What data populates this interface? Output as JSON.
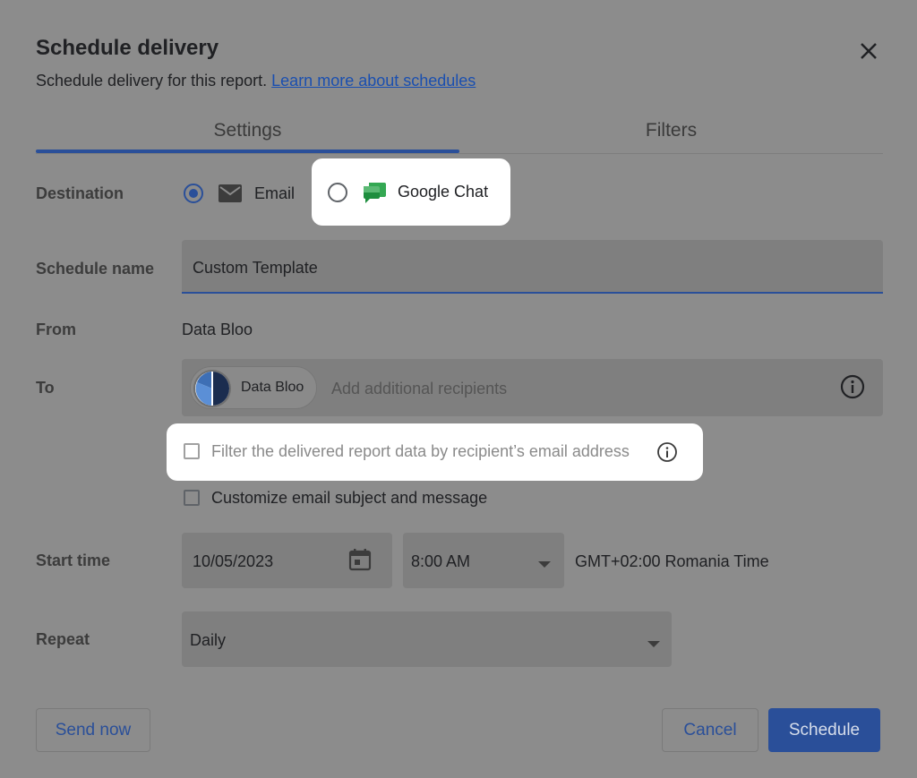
{
  "dialog": {
    "title": "Schedule delivery",
    "subtitle": "Schedule delivery for this report.",
    "learn_more_link": "Learn more about schedules"
  },
  "tabs": [
    {
      "label": "Settings",
      "selected": true
    },
    {
      "label": "Filters",
      "selected": false
    }
  ],
  "destination": {
    "label": "Destination",
    "options": [
      {
        "label": "Email",
        "selected": true,
        "icon": "email-icon"
      },
      {
        "label": "Google Chat",
        "selected": false,
        "icon": "google-chat-icon"
      }
    ]
  },
  "schedule_name": {
    "label": "Schedule name",
    "value": "Custom Template"
  },
  "from": {
    "label": "From",
    "value": "Data Bloo"
  },
  "to": {
    "label": "To",
    "chip_label": "Data Bloo",
    "placeholder": "Add additional recipients"
  },
  "options": {
    "filter_by_email": {
      "label": "Filter the delivered report data by recipient’s email address",
      "checked": false
    },
    "customize_email": {
      "label": "Customize email subject and message",
      "checked": false
    }
  },
  "start_time": {
    "label": "Start time",
    "date": "10/05/2023",
    "time": "8:00 AM",
    "timezone": "GMT+02:00 Romania Time"
  },
  "repeat": {
    "label": "Repeat",
    "value": "Daily"
  },
  "buttons": {
    "send_now": "Send now",
    "cancel": "Cancel",
    "schedule": "Schedule"
  },
  "colors": {
    "accent": "#2a4f99",
    "overlay_background": "#8c8c8c",
    "highlight": "#ffffff"
  }
}
